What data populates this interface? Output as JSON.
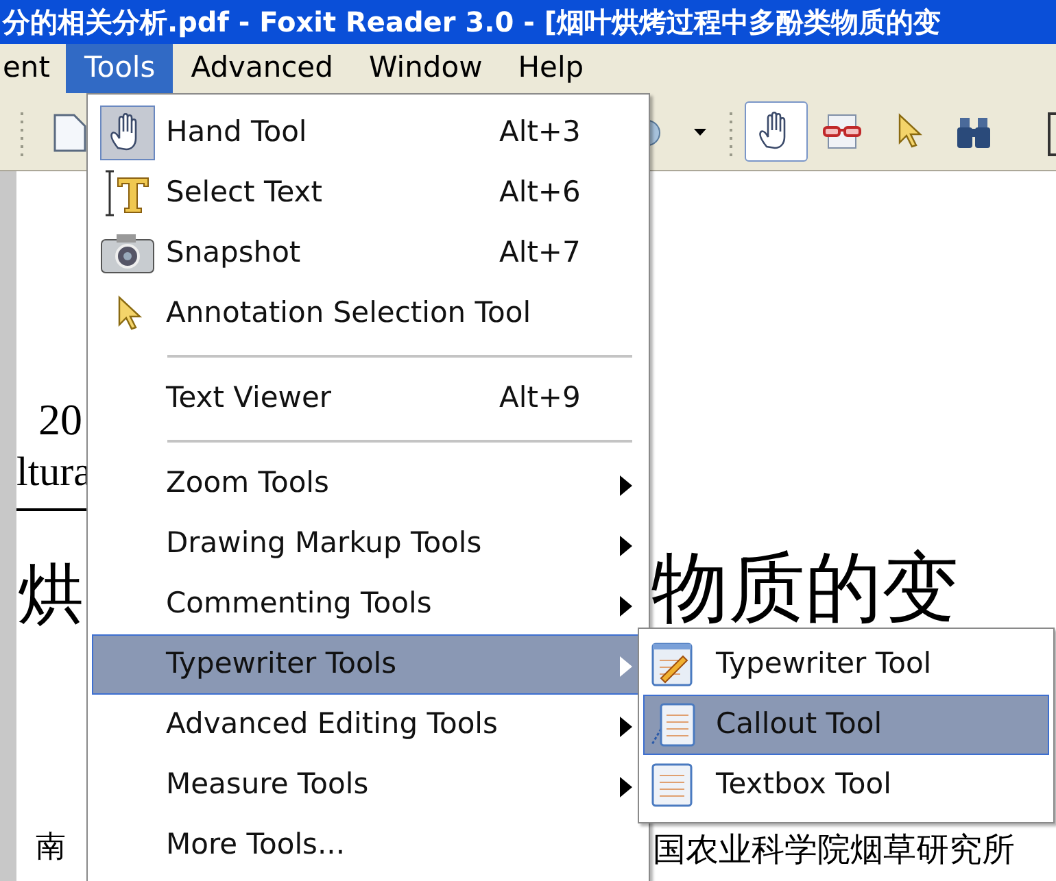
{
  "window": {
    "title": "分的相关分析.pdf - Foxit Reader 3.0 - [烟叶烘烤过程中多酚类物质的变"
  },
  "menubar": [
    {
      "label": "ent",
      "selected": false
    },
    {
      "label": "Tools",
      "selected": true
    },
    {
      "label": "Advanced",
      "selected": false
    },
    {
      "label": "Window",
      "selected": false
    },
    {
      "label": "Help",
      "selected": false
    }
  ],
  "toolbar": [
    {
      "pressed": true
    },
    {
      "pressed": false
    },
    {
      "pressed": false
    },
    {
      "pressed": false
    }
  ],
  "document": {
    "texts": [
      "20",
      "ltura",
      "烘",
      "物质的变",
      "南",
      "国农业科学院烟草研究所"
    ]
  },
  "menu": [
    {
      "kind": "item",
      "label": "Hand Tool",
      "shortcut": "Alt+3",
      "checked": true,
      "selected": false
    },
    {
      "kind": "item",
      "label": "Select Text",
      "shortcut": "Alt+6",
      "checked": false,
      "selected": false
    },
    {
      "kind": "item",
      "label": "Snapshot",
      "shortcut": "Alt+7",
      "checked": false,
      "selected": false
    },
    {
      "kind": "item",
      "label": "Annotation Selection Tool",
      "checked": false,
      "selected": false
    },
    {
      "kind": "separator"
    },
    {
      "kind": "item",
      "label": "Text Viewer",
      "shortcut": "Alt+9",
      "checked": false,
      "selected": false
    },
    {
      "kind": "separator"
    },
    {
      "kind": "submenu",
      "label": "Zoom Tools",
      "selected": false
    },
    {
      "kind": "submenu",
      "label": "Drawing Markup Tools",
      "selected": false
    },
    {
      "kind": "submenu",
      "label": "Commenting Tools",
      "selected": false
    },
    {
      "kind": "submenu",
      "label": "Typewriter Tools",
      "selected": true
    },
    {
      "kind": "submenu",
      "label": "Advanced Editing Tools",
      "selected": false
    },
    {
      "kind": "submenu",
      "label": "Measure Tools",
      "selected": false
    },
    {
      "kind": "item",
      "label": "More Tools...",
      "checked": false,
      "selected": false
    }
  ],
  "submenu": [
    {
      "label": "Typewriter Tool",
      "selected": false
    },
    {
      "label": "Callout Tool",
      "selected": true
    },
    {
      "label": "Textbox Tool",
      "selected": false
    }
  ]
}
